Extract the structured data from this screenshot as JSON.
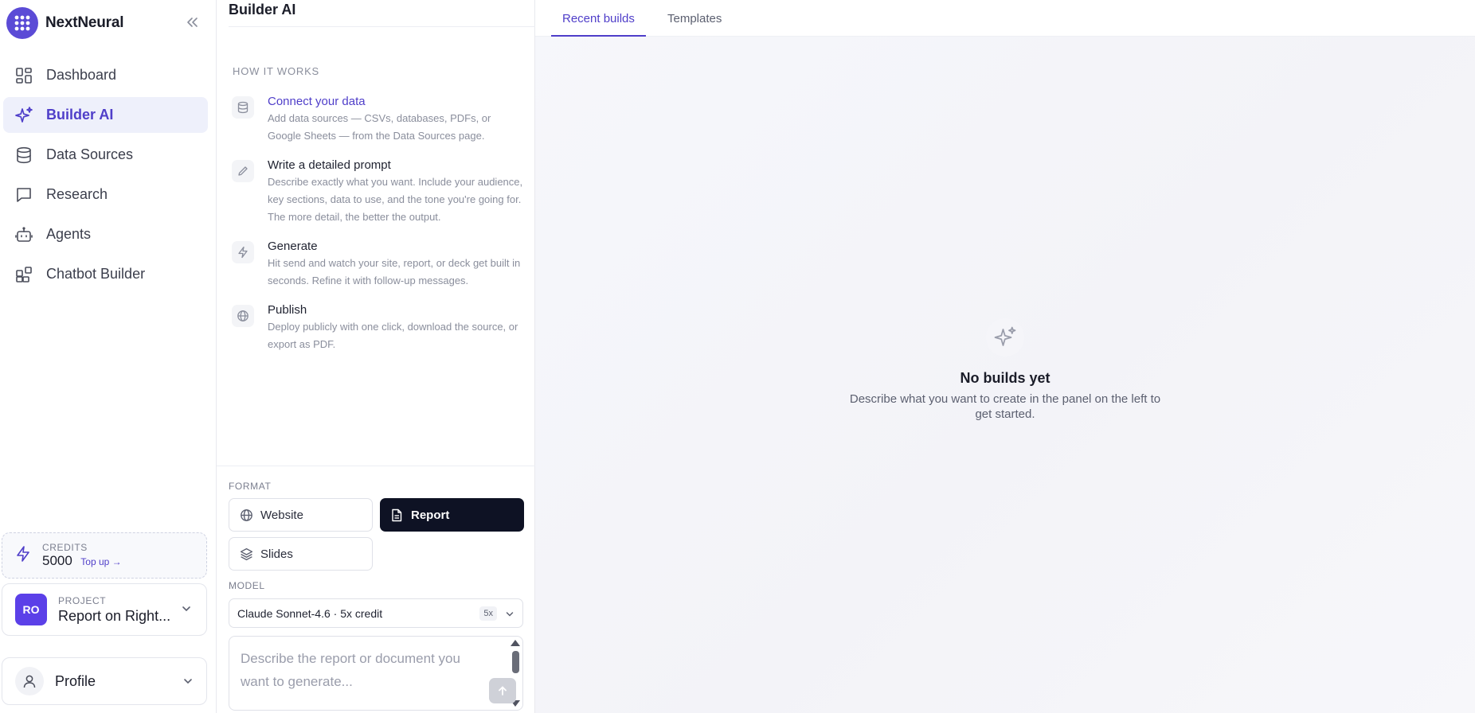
{
  "brand": {
    "name": "NextNeural"
  },
  "sidebar": {
    "items": [
      {
        "label": "Dashboard",
        "icon": "dashboard-grid-icon"
      },
      {
        "label": "Builder AI",
        "icon": "sparkles-icon",
        "active": true
      },
      {
        "label": "Data Sources",
        "icon": "database-icon"
      },
      {
        "label": "Research",
        "icon": "chat-bubble-icon"
      },
      {
        "label": "Agents",
        "icon": "bot-icon"
      },
      {
        "label": "Chatbot Builder",
        "icon": "blocks-icon"
      }
    ],
    "credits": {
      "label": "CREDITS",
      "value": "5000",
      "topup": "Top up →"
    },
    "project": {
      "label": "PROJECT",
      "initials": "RO",
      "name": "Report on Right..."
    },
    "profile": {
      "label": "Profile"
    }
  },
  "panel": {
    "title": "Builder AI",
    "how_heading": "HOW IT WORKS",
    "steps": [
      {
        "title": "Connect your data",
        "desc": "Add data sources — CSVs, databases, PDFs, or Google Sheets — from the Data Sources page."
      },
      {
        "title": "Write a detailed prompt",
        "desc": "Describe exactly what you want. Include your audience, key sections, data to use, and the tone you're going for. The more detail, the better the output."
      },
      {
        "title": "Generate",
        "desc": "Hit send and watch your site, report, or deck get built in seconds. Refine it with follow-up messages."
      },
      {
        "title": "Publish",
        "desc": "Deploy publicly with one click, download the source, or export as PDF."
      }
    ],
    "format": {
      "label": "FORMAT",
      "options": [
        {
          "label": "Website",
          "icon": "globe-icon"
        },
        {
          "label": "Report",
          "icon": "document-icon",
          "selected": true
        },
        {
          "label": "Slides",
          "icon": "layers-icon"
        }
      ]
    },
    "model": {
      "label": "MODEL",
      "value": "Claude Sonnet-4.6 · 5x credit",
      "badge": "5x"
    },
    "prompt": {
      "placeholder": "Describe the report or document you want to generate..."
    }
  },
  "main": {
    "tabs": [
      {
        "label": "Recent builds",
        "active": true
      },
      {
        "label": "Templates"
      }
    ],
    "empty": {
      "title": "No builds yet",
      "desc": "Describe what you want to create in the panel on the left to get started."
    }
  },
  "colors": {
    "accent": "#4f3ec9",
    "brand": "#5b4bd6",
    "dark_button": "#0e1224",
    "avatar": "#5b40e8"
  }
}
